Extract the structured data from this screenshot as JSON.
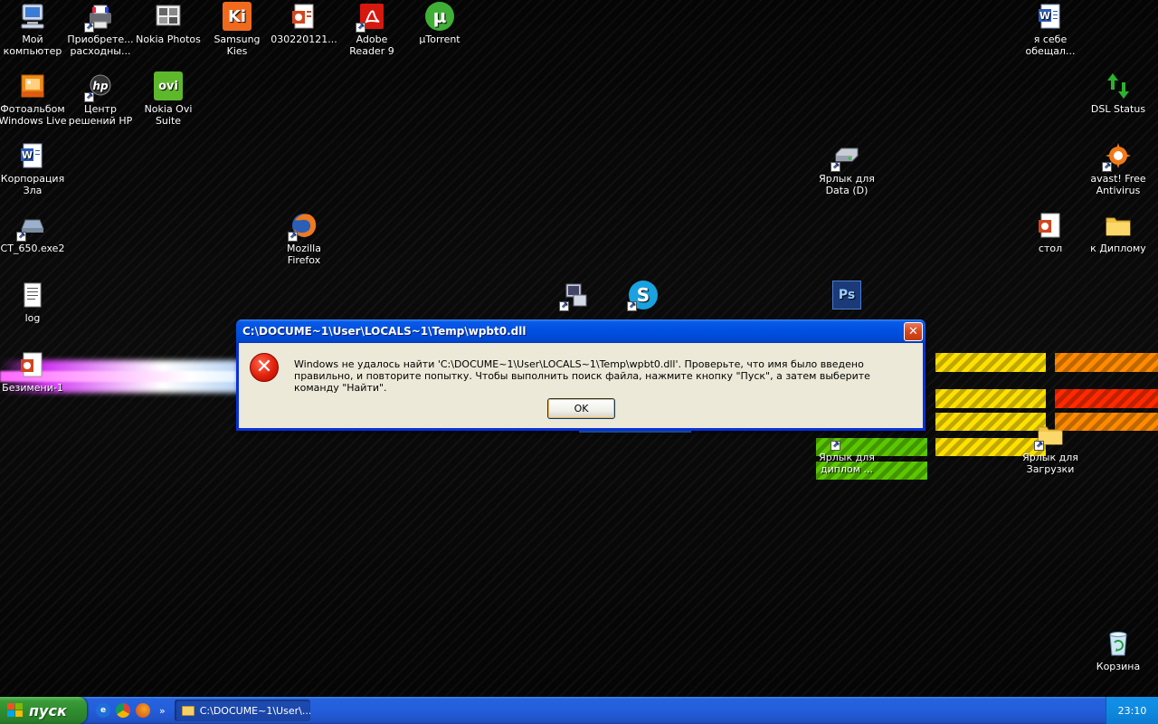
{
  "desktop": {
    "icons": [
      {
        "label": "Мой компьютер",
        "icon": "my-computer-icon",
        "shortcut": false
      },
      {
        "label": "Приобрете... расходны...",
        "icon": "printer-supplies-icon",
        "shortcut": true
      },
      {
        "label": "Nokia Photos",
        "icon": "nokia-photos-icon",
        "shortcut": false
      },
      {
        "label": "Samsung Kies",
        "icon": "samsung-kies-icon",
        "shortcut": false
      },
      {
        "label": "030220121...",
        "icon": "presentation-file-icon",
        "shortcut": false
      },
      {
        "label": "Adobe Reader 9",
        "icon": "adobe-reader-icon",
        "shortcut": true
      },
      {
        "label": "µTorrent",
        "icon": "utorrent-icon",
        "shortcut": false
      },
      {
        "label": "я себе обещал...",
        "icon": "word-document-icon",
        "shortcut": false
      },
      {
        "label": "Фотоальбом Windows Live",
        "icon": "photo-gallery-icon",
        "shortcut": false
      },
      {
        "label": "Центр решений HP",
        "icon": "hp-solution-center-icon",
        "shortcut": true
      },
      {
        "label": "Nokia Ovi Suite",
        "icon": "nokia-ovi-icon",
        "shortcut": false
      },
      {
        "label": "DSL Status",
        "icon": "dsl-status-icon",
        "shortcut": false
      },
      {
        "label": "Корпорация Зла",
        "icon": "word-document-icon",
        "shortcut": false
      },
      {
        "label": "Ярлык для Data (D)",
        "icon": "drive-icon",
        "shortcut": true
      },
      {
        "label": "avast! Free Antivirus",
        "icon": "avast-icon",
        "shortcut": true
      },
      {
        "label": "CT_650.exe2",
        "icon": "exe-file-icon",
        "shortcut": true
      },
      {
        "label": "Mozilla Firefox",
        "icon": "firefox-icon",
        "shortcut": true
      },
      {
        "label": "стол",
        "icon": "presentation-file-icon",
        "shortcut": false
      },
      {
        "label": "к Диплому",
        "icon": "folder-icon",
        "shortcut": false
      },
      {
        "label": "log",
        "icon": "text-file-icon",
        "shortcut": false
      },
      {
        "label": "Безимени-1",
        "icon": "presentation-file-icon",
        "shortcut": false
      },
      {
        "label": "",
        "icon": "network-computer-icon",
        "shortcut": true
      },
      {
        "label": "",
        "icon": "skype-icon",
        "shortcut": true
      },
      {
        "label": "",
        "icon": "photoshop-icon",
        "shortcut": false
      },
      {
        "label": "Ярлык для диплом ...",
        "icon": "folder-shortcut-icon",
        "shortcut": true
      },
      {
        "label": "Ярлык для Загрузки",
        "icon": "folder-icon",
        "shortcut": true
      },
      {
        "label": "Корзина",
        "icon": "recycle-bin-icon",
        "shortcut": false
      }
    ]
  },
  "dialog": {
    "title": "C:\\DOCUME~1\\User\\LOCALS~1\\Temp\\wpbt0.dll",
    "close_glyph": "✕",
    "icon": "error-icon",
    "message": "Windows не удалось найти 'C:\\DOCUME~1\\User\\LOCALS~1\\Temp\\wpbt0.dll'. Проверьте, что имя было введено правильно, и повторите попытку. Чтобы выполнить поиск файла, нажмите кнопку \"Пуск\", а затем выберите команду \"Найти\".",
    "ok_label": "OK"
  },
  "taskbar": {
    "start_label": "пуск",
    "quicklaunch": [
      "ie-icon",
      "chrome-icon",
      "firefox-icon"
    ],
    "chevron": "»",
    "task_label": "C:\\DOCUME~1\\User\\...",
    "clock": "23:10"
  },
  "colors": {
    "taskbar_blue": "#245edb",
    "start_green": "#2f8e2f",
    "dialog_face": "#ece9d8",
    "titlebar_blue": "#0050e0"
  }
}
